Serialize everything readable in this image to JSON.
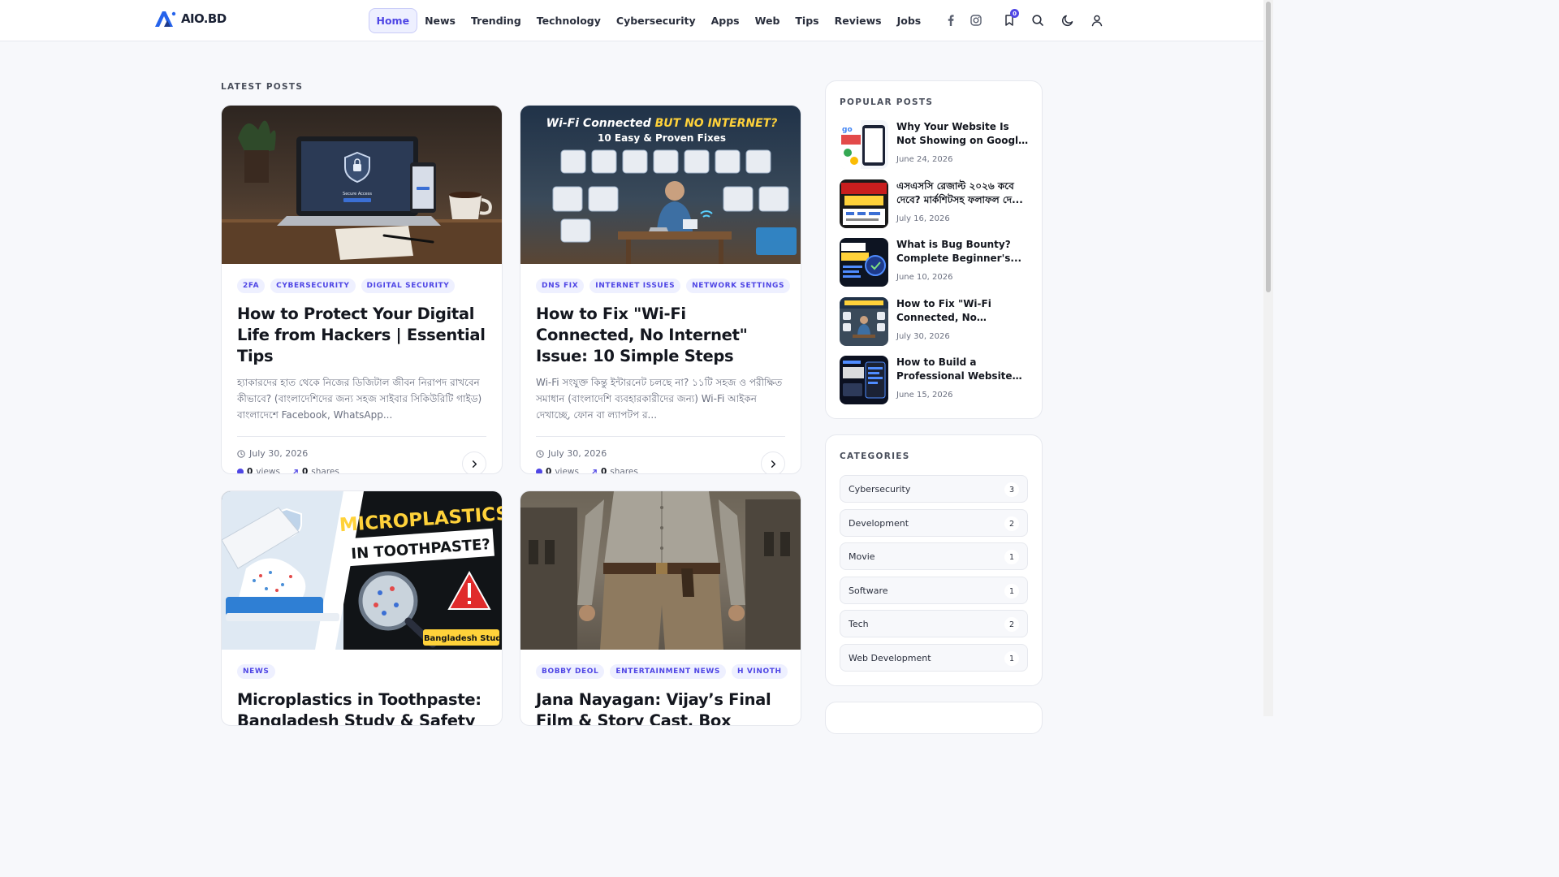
{
  "header": {
    "logo_text": "AIO.BD",
    "nav": [
      "Home",
      "News",
      "Trending",
      "Technology",
      "Cybersecurity",
      "Apps",
      "Web",
      "Tips",
      "Reviews",
      "Jobs"
    ],
    "active_nav": "Home",
    "bookmark_count": "0",
    "icons": [
      "facebook-icon",
      "instagram-icon",
      "bookmark-icon",
      "search-icon",
      "moon-icon",
      "user-icon"
    ]
  },
  "main": {
    "section_label": "LATEST POSTS",
    "posts": [
      {
        "tags": [
          "2FA",
          "CYBERSECURITY",
          "DIGITAL SECURITY"
        ],
        "title": "How to Protect Your Digital Life from Hackers | Essential Tips",
        "excerpt": "হ্যাকারদের হাত থেকে নিজের ডিজিটাল জীবন নিরাপদ রাখবেন কীভাবে? (বাংলাদেশিদের জন্য সহজ সাইবার সিকিউরিটি গাইড) বাংলাদেশে Facebook, WhatsApp...",
        "date": "July 30, 2026",
        "views": "0",
        "views_label": "views",
        "shares": "0",
        "shares_label": "shares",
        "image_text": "Secure Access"
      },
      {
        "tags": [
          "DNS FIX",
          "INTERNET ISSUES",
          "NETWORK SETTINGS"
        ],
        "title": "How to Fix \"Wi-Fi Connected, No Internet\" Issue: 10 Simple Steps",
        "excerpt": "Wi-Fi সংযুক্ত কিন্তু ইন্টারনেট চলছে না? ১১টি সহজ ও পরীক্ষিত সমাধান (বাংলাদেশি ব্যবহারকারীদের জন্য) Wi-Fi আইকন দেখাচ্ছে, ফোন বা ল্যাপটপ র...",
        "date": "July 30, 2026",
        "views": "0",
        "views_label": "views",
        "shares": "0",
        "shares_label": "shares",
        "image_text_1": "Wi-Fi Connected ",
        "image_text_2": "BUT NO INTERNET?",
        "image_text_3": "10 Easy & Proven Fixes"
      },
      {
        "tags": [
          "NEWS"
        ],
        "title": "Microplastics in Toothpaste: Bangladesh Study & Safety",
        "image_text_1": "MICROPLASTICS",
        "image_text_2": "IN TOOTHPASTE?",
        "image_text_3": "Bangladesh Study"
      },
      {
        "tags": [
          "BOBBY DEOL",
          "ENTERTAINMENT NEWS",
          "H VINOTH"
        ],
        "title": "Jana Nayagan: Vijay’s Final Film & Story Cast, Box Office &"
      }
    ]
  },
  "sidebar": {
    "popular_title": "POPULAR POSTS",
    "popular": [
      {
        "title": "Why Your Website Is Not Showing on Google? Fix I...",
        "date": "June 24, 2026"
      },
      {
        "title": "এসএসসি রেজাল্ট ২০২৬ কবে দেবে? মার্কশিটসহ ফলাফল দে...",
        "date": "July 16, 2026"
      },
      {
        "title": "What is Bug Bounty? Complete Beginner's...",
        "date": "June 10, 2026"
      },
      {
        "title": "How to Fix \"Wi-Fi Connected, No Internet\"...",
        "date": "July 30, 2026"
      },
      {
        "title": "How to Build a Professional Website for...",
        "date": "June 15, 2026"
      }
    ],
    "categories_title": "CATEGORIES",
    "categories": [
      {
        "name": "Cybersecurity",
        "count": "3"
      },
      {
        "name": "Development",
        "count": "2"
      },
      {
        "name": "Movie",
        "count": "1"
      },
      {
        "name": "Software",
        "count": "1"
      },
      {
        "name": "Tech",
        "count": "2"
      },
      {
        "name": "Web Development",
        "count": "1"
      }
    ]
  },
  "colors": {
    "accent": "#4f46e5",
    "text": "#14171f",
    "muted": "#6b7080",
    "bg": "#f7f8fb"
  }
}
